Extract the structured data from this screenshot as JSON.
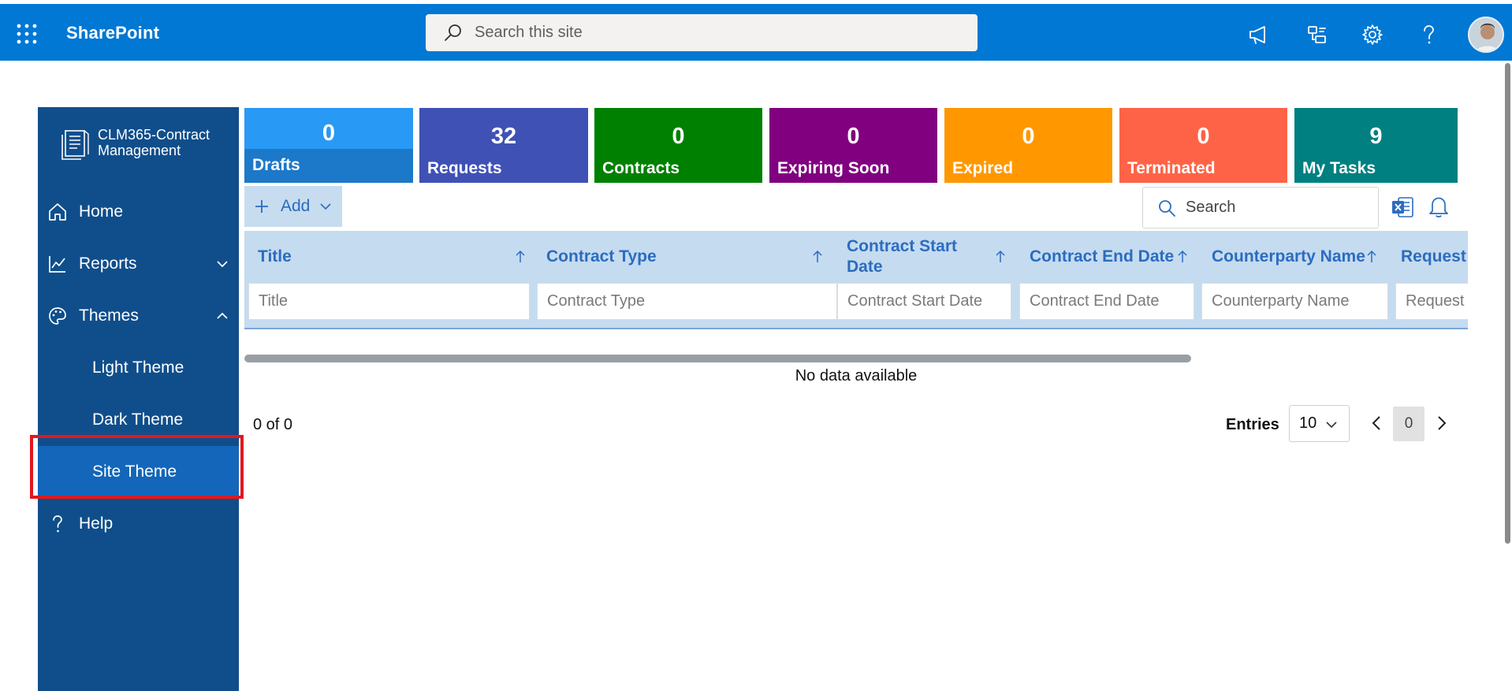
{
  "suitebar": {
    "brand": "SharePoint",
    "search_placeholder": "Search this site"
  },
  "sidebar": {
    "app_title_line1": "CLM365-Contract",
    "app_title_line2": "Management",
    "items": [
      {
        "label": "Home",
        "icon": "home-icon"
      },
      {
        "label": "Reports",
        "icon": "chart-icon",
        "expanded": false
      },
      {
        "label": "Themes",
        "icon": "palette-icon",
        "expanded": true
      },
      {
        "label": "Light Theme"
      },
      {
        "label": "Dark Theme"
      },
      {
        "label": "Site Theme",
        "active": true
      },
      {
        "label": "Help",
        "icon": "help-icon"
      }
    ]
  },
  "tiles": [
    {
      "count": "0",
      "label": "Drafts",
      "color": "#2899f5"
    },
    {
      "count": "32",
      "label": "Requests",
      "color": "#3f51b5"
    },
    {
      "count": "0",
      "label": "Contracts",
      "color": "#008000"
    },
    {
      "count": "0",
      "label": "Expiring Soon",
      "color": "#800080"
    },
    {
      "count": "0",
      "label": "Expired",
      "color": "#ff9800"
    },
    {
      "count": "0",
      "label": "Terminated",
      "color": "#ff6347"
    },
    {
      "count": "9",
      "label": "My Tasks",
      "color": "#008080"
    }
  ],
  "toolbar": {
    "add_label": "Add",
    "search_placeholder": "Search"
  },
  "grid": {
    "columns": [
      {
        "header": "Title",
        "filter_placeholder": "Title"
      },
      {
        "header": "Contract Type",
        "filter_placeholder": "Contract Type"
      },
      {
        "header": "Contract Start Date",
        "filter_placeholder": "Contract Start Date"
      },
      {
        "header": "Contract End Date",
        "filter_placeholder": "Contract End Date"
      },
      {
        "header": "Counterparty Name",
        "filter_placeholder": "Counterparty Name"
      },
      {
        "header": "Request",
        "filter_placeholder": "Request"
      }
    ],
    "empty_message": "No data available"
  },
  "pager": {
    "info": "0 of 0",
    "entries_label": "Entries",
    "entries_value": "10",
    "current_page": "0"
  },
  "colors": {
    "suitebar": "#0078d4",
    "sidebar": "#104e8b",
    "sidebar_active": "#1366b9",
    "grid_header": "#c5dbf0",
    "accent_text": "#2b6cbf",
    "highlight": "#e3171c"
  }
}
